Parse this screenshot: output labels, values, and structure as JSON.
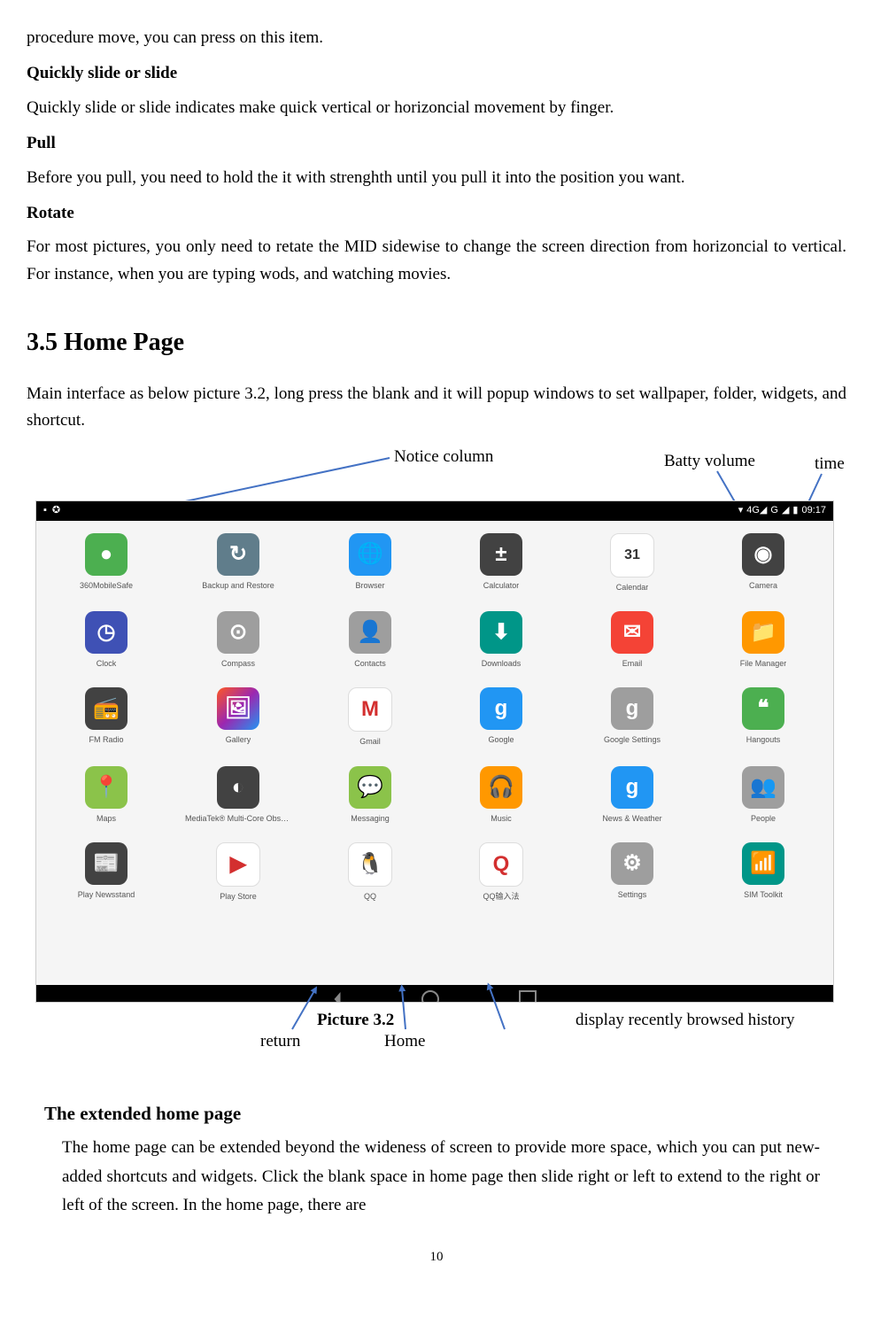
{
  "intro": {
    "procedure": "procedure move, you can press on this item.",
    "quickSlideH": "Quickly slide or slide",
    "quickSlideP": "Quickly slide or slide indicates make quick vertical or horizoncial movement by finger.",
    "pullH": "Pull",
    "pullP": "Before you pull, you need to hold the it with strenghth until you pull it into the position you want.",
    "rotateH": "Rotate",
    "rotateP": "For most pictures, you only need to retate the MID sidewise to change the screen direction from horizoncial to vertical. For instance, when you are typing wods, and watching movies."
  },
  "section": {
    "title": "3.5 Home Page",
    "intro": "Main interface as below picture 3.2, long press the blank and it will popup windows to set wallpaper, folder, widgets, and shortcut."
  },
  "annotations": {
    "notice": "Notice column",
    "batty": "Batty volume",
    "time_lbl": "time",
    "picture": "Picture 3.2",
    "return": "return",
    "home": "Home",
    "history": "display recently browsed history"
  },
  "statusbar": {
    "time": "09:17",
    "net": "4G◢",
    "g": "G"
  },
  "apps": [
    {
      "label": "360MobileSafe",
      "bg": "#4caf50",
      "glyph": "●"
    },
    {
      "label": "Backup and Restore",
      "bg": "#607d8b",
      "glyph": "↻"
    },
    {
      "label": "Browser",
      "bg": "#2196f3",
      "glyph": "🌐"
    },
    {
      "label": "Calculator",
      "bg": "#424242",
      "glyph": "±"
    },
    {
      "label": "Calendar",
      "bg": "#ffffff",
      "glyph": "31"
    },
    {
      "label": "Camera",
      "bg": "#424242",
      "glyph": "◉"
    },
    {
      "label": "Clock",
      "bg": "#3f51b5",
      "glyph": "◷"
    },
    {
      "label": "Compass",
      "bg": "#9e9e9e",
      "glyph": "⊙"
    },
    {
      "label": "Contacts",
      "bg": "#9e9e9e",
      "glyph": "👤"
    },
    {
      "label": "Downloads",
      "bg": "#009688",
      "glyph": "⬇"
    },
    {
      "label": "Email",
      "bg": "#f44336",
      "glyph": "✉"
    },
    {
      "label": "File Manager",
      "bg": "#ff9800",
      "glyph": "📁"
    },
    {
      "label": "FM Radio",
      "bg": "#424242",
      "glyph": "📻"
    },
    {
      "label": "Gallery",
      "bg": "linear",
      "glyph": "🖼"
    },
    {
      "label": "Gmail",
      "bg": "#ffffff",
      "glyph": "M"
    },
    {
      "label": "Google",
      "bg": "#2196f3",
      "glyph": "g"
    },
    {
      "label": "Google Settings",
      "bg": "#9e9e9e",
      "glyph": "g"
    },
    {
      "label": "Hangouts",
      "bg": "#4caf50",
      "glyph": "❝"
    },
    {
      "label": "Maps",
      "bg": "#8bc34a",
      "glyph": "📍"
    },
    {
      "label": "MediaTek® Multi-Core Obser..",
      "bg": "#424242",
      "glyph": "◐"
    },
    {
      "label": "Messaging",
      "bg": "#8bc34a",
      "glyph": "💬"
    },
    {
      "label": "Music",
      "bg": "#ff9800",
      "glyph": "🎧"
    },
    {
      "label": "News & Weather",
      "bg": "#2196f3",
      "glyph": "g"
    },
    {
      "label": "People",
      "bg": "#9e9e9e",
      "glyph": "👥"
    },
    {
      "label": "Play Newsstand",
      "bg": "#424242",
      "glyph": "📰"
    },
    {
      "label": "Play Store",
      "bg": "#ffffff",
      "glyph": "▶"
    },
    {
      "label": "QQ",
      "bg": "#ffffff",
      "glyph": "🐧"
    },
    {
      "label": "QQ输入法",
      "bg": "#ffffff",
      "glyph": "Q"
    },
    {
      "label": "Settings",
      "bg": "#9e9e9e",
      "glyph": "⚙"
    },
    {
      "label": "SIM Toolkit",
      "bg": "#009688",
      "glyph": "📶"
    }
  ],
  "extended": {
    "heading": "The extended home page",
    "body": "The home page can be extended beyond the wideness of screen to provide more space, which you can put new-added shortcuts and widgets. Click the blank space in home page then slide right or left to extend to the right or left of the screen. In the home page, there are"
  },
  "pageNumber": "10"
}
